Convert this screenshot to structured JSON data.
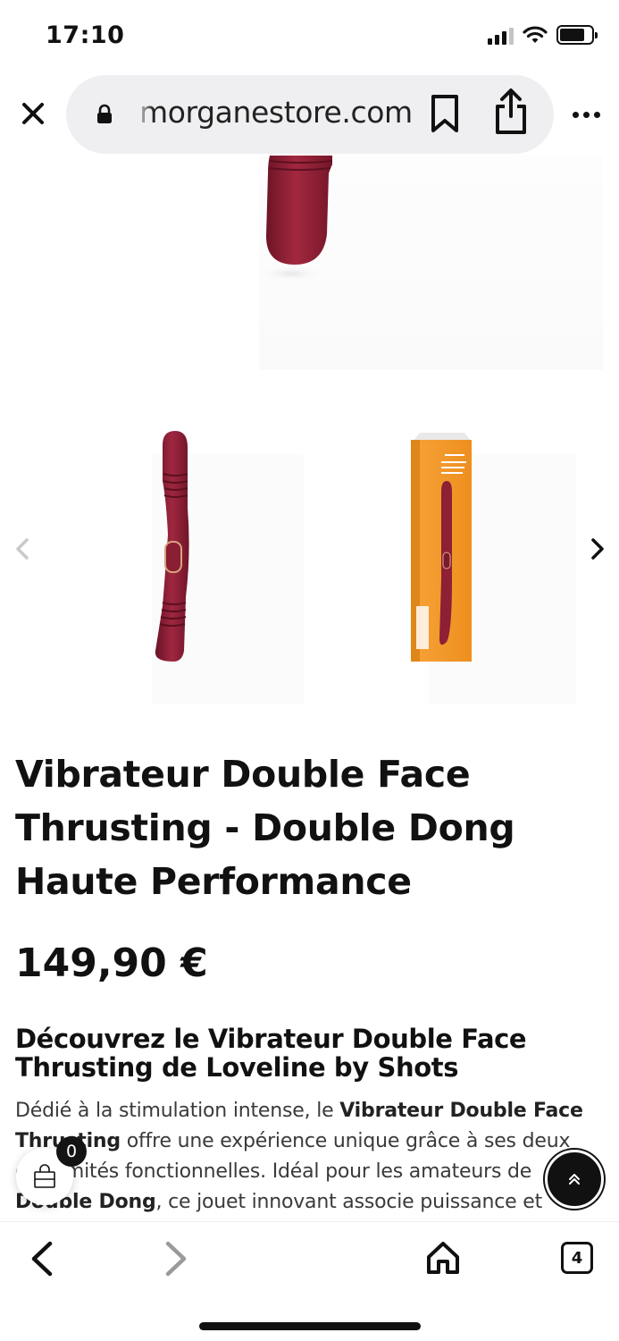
{
  "status_bar": {
    "time": "17:10",
    "icons": [
      "cellular-signal-icon",
      "wifi-icon",
      "battery-icon"
    ]
  },
  "browser": {
    "url": "morganestore.com",
    "icons": [
      "close-icon",
      "lock-icon",
      "bookmark-icon",
      "share-icon",
      "more-icon"
    ]
  },
  "product": {
    "title": "Vibrateur Double Face Thrusting - Double Dong Haute Performance",
    "price": "149,90 €",
    "image_alt": [
      "burgundy double dong vibrator",
      "orange product box"
    ]
  },
  "description": {
    "heading": "Découvrez le Vibrateur Double Face Thrusting de Loveline by Shots",
    "p1_start": "Dédié à la stimulation intense, le ",
    "p1_bold1": "Vibrateur Double Face Thrusting",
    "p1_mid": " offre une expérience unique grâce à ses deux extrémités fonctionnelles. Idéal pour les amateurs de ",
    "p1_bold2": "Double Dong",
    "p1_end": ", ce jouet innovant associe puissance et douceur pour un plaisir diversifié et partagé."
  },
  "cart": {
    "count": "0"
  },
  "toolbar": {
    "tab_count": "4"
  },
  "colors": {
    "product": "#8e1f34",
    "box": "#f39b2a",
    "url_pill": "#efeff1"
  }
}
